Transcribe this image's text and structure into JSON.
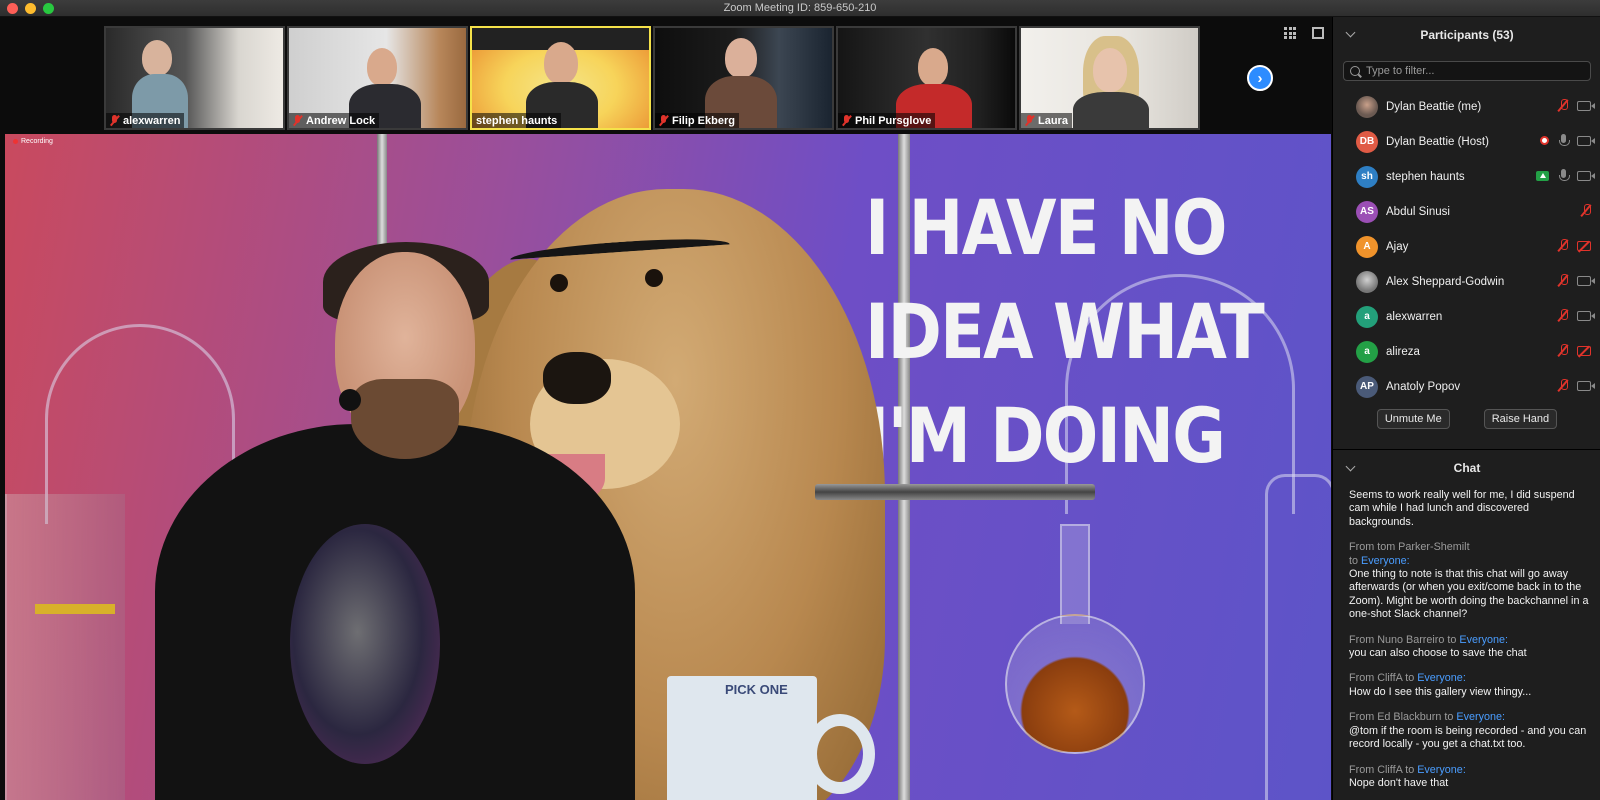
{
  "window": {
    "title": "Zoom Meeting ID: 859-650-210"
  },
  "gallery": {
    "tiles": [
      {
        "name": "alexwarren",
        "muted": true,
        "active": false
      },
      {
        "name": "Andrew Lock",
        "muted": true,
        "active": false
      },
      {
        "name": "stephen haunts",
        "muted": false,
        "active": true
      },
      {
        "name": "Filip Ekberg",
        "muted": true,
        "active": false
      },
      {
        "name": "Phil Pursglove",
        "muted": true,
        "active": false
      },
      {
        "name": "Laura",
        "muted": true,
        "active": false
      }
    ],
    "next_icon": "chevron-right-icon",
    "grid_icon": "grid-view-icon",
    "fullscreen_icon": "fullscreen-icon"
  },
  "video": {
    "recording_label": "Recording",
    "meme_lines": [
      "I HAVE NO",
      "IDEA WHAT",
      "I'M DOING"
    ],
    "mug_text": "PICK ONE"
  },
  "participants": {
    "header": "Participants (53)",
    "filter_placeholder": "Type to filter...",
    "list": [
      {
        "name": "Dylan Beattie (me)",
        "initials": "",
        "avatar_color": "#6b5a52",
        "photo": true,
        "icons": [
          "mic-off",
          "cam"
        ]
      },
      {
        "name": "Dylan Beattie (Host)",
        "initials": "DB",
        "avatar_color": "#e05b45",
        "photo": false,
        "icons": [
          "rec",
          "mic",
          "cam"
        ]
      },
      {
        "name": "stephen haunts",
        "initials": "sh",
        "avatar_color": "#2e7fc4",
        "photo": false,
        "icons": [
          "share",
          "mic",
          "cam"
        ]
      },
      {
        "name": "Abdul Sinusi",
        "initials": "AS",
        "avatar_color": "#9b4fb5",
        "photo": false,
        "icons": [
          "mic-off"
        ]
      },
      {
        "name": "Ajay",
        "initials": "A",
        "avatar_color": "#f0932b",
        "photo": false,
        "icons": [
          "mic-off",
          "cam-off"
        ]
      },
      {
        "name": "Alex Sheppard-Godwin",
        "initials": "",
        "avatar_color": "#777777",
        "photo": true,
        "icons": [
          "mic-off",
          "cam"
        ]
      },
      {
        "name": "alexwarren",
        "initials": "a",
        "avatar_color": "#23a07a",
        "photo": false,
        "icons": [
          "mic-off",
          "cam"
        ]
      },
      {
        "name": "alireza",
        "initials": "a",
        "avatar_color": "#23a046",
        "photo": false,
        "icons": [
          "mic-off",
          "cam-off"
        ]
      },
      {
        "name": "Anatoly Popov",
        "initials": "AP",
        "avatar_color": "#4a5a78",
        "photo": false,
        "icons": [
          "mic-off",
          "cam"
        ]
      }
    ],
    "unmute_label": "Unmute Me",
    "raise_hand_label": "Raise Hand"
  },
  "chat": {
    "header": "Chat",
    "messages": [
      {
        "from": "",
        "to": "",
        "text": "Seems to work really well for me, I did suspend cam while I had lunch and discovered backgrounds."
      },
      {
        "from": "From tom Parker-Shemilt",
        "to": "Everyone:",
        "text": "One thing to note is that this chat will go away afterwards (or when you exit/come back in to the Zoom). Might be worth doing the backchannel in a one-shot Slack channel?"
      },
      {
        "from": "From Nuno Barreiro to",
        "to": "Everyone:",
        "text": "you can also choose to save the chat"
      },
      {
        "from": "From CliffA to",
        "to": "Everyone:",
        "text": "How do I see this gallery view thingy..."
      },
      {
        "from": "From Ed Blackburn to",
        "to": "Everyone:",
        "text": "@tom if the room is being recorded - and you can record locally - you get a chat.txt too."
      },
      {
        "from": "From CliffA to",
        "to": "Everyone:",
        "text": "Nope don't have that"
      }
    ]
  }
}
